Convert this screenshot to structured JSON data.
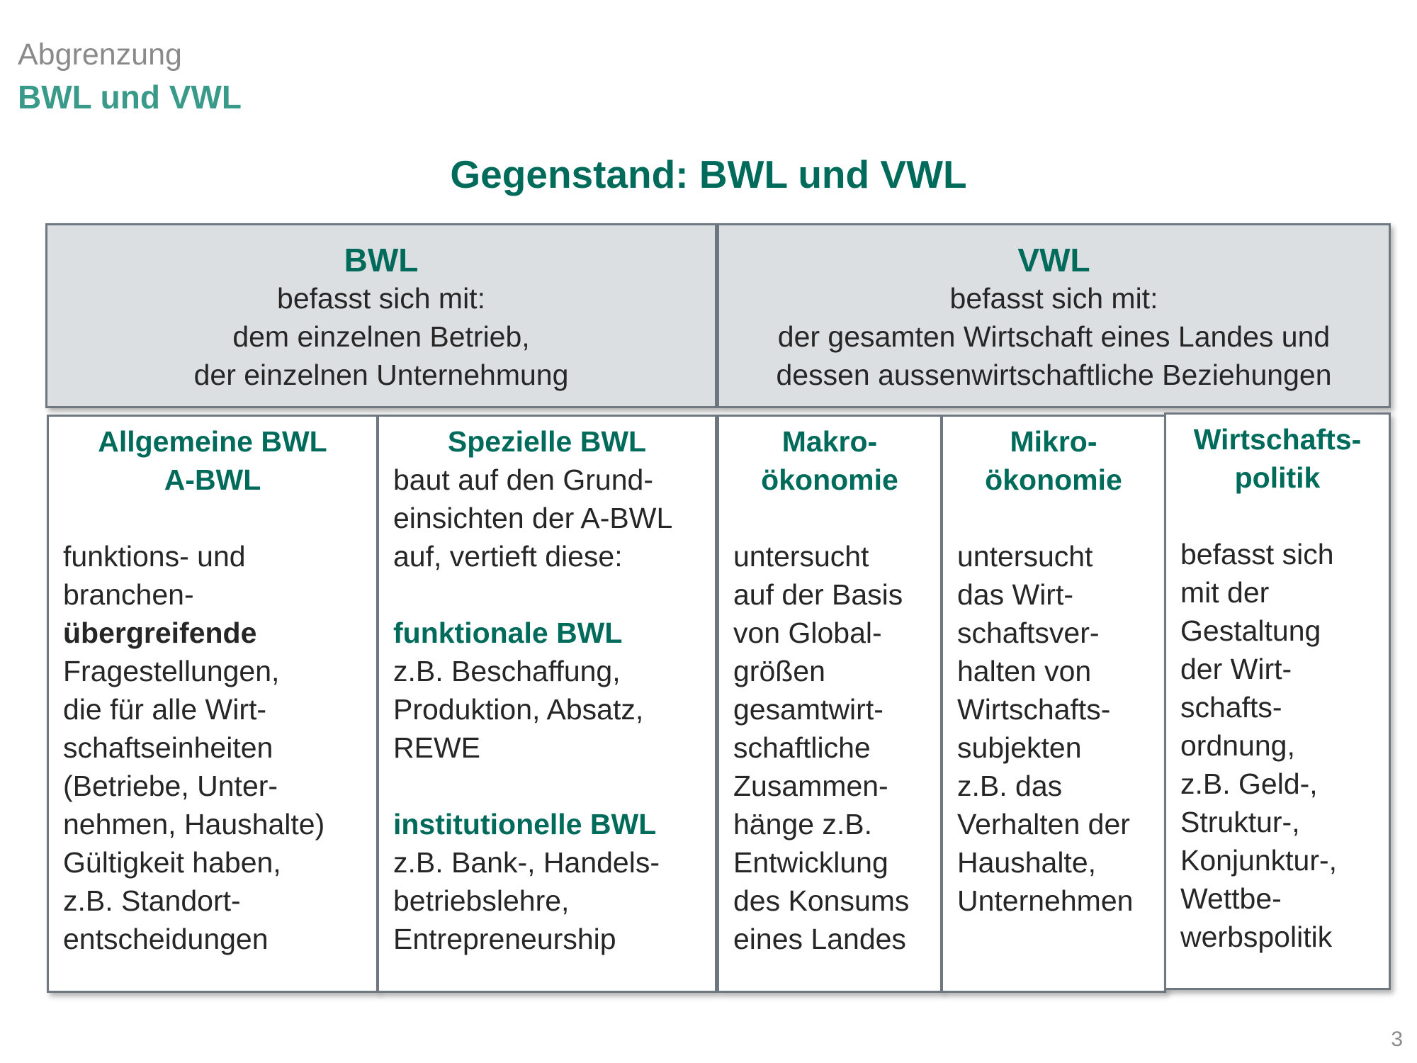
{
  "header": {
    "subtitle": "Abgrenzung",
    "title": "BWL und VWL"
  },
  "main_title": "Gegenstand: BWL und VWL",
  "bwl_box": {
    "title": "BWL",
    "line1": "befasst sich mit:",
    "line2": "dem einzelnen Betrieb,",
    "line3": "der einzelnen Unternehmung"
  },
  "vwl_box": {
    "title": "VWL",
    "line1": "befasst sich mit:",
    "line2": "der gesamten Wirtschaft eines Landes und",
    "line3": "dessen aussenwirtschaftliche Beziehungen"
  },
  "columns": {
    "abwl": {
      "title": "Allgemeine BWL\nA-BWL",
      "text_a": "funktions- und\nbranchen-",
      "text_bold": "übergreifende",
      "text_b": "Fragestellungen,\ndie für alle Wirt-\nschaftseinheiten\n(Betriebe, Unter-\nnehmen, Haushalte)\nGültigkeit haben,\nz.B. Standort-\nentscheidungen"
    },
    "sbwl": {
      "title": "Spezielle BWL",
      "intro": "baut auf den Grund-\neinsichten der A-BWL\nauf, vertieft diese:",
      "func_title": "funktionale BWL",
      "func_text": "z.B. Beschaffung,\nProduktion, Absatz,\nREWE",
      "inst_title": "institutionelle BWL",
      "inst_text": "z.B. Bank-, Handels-\nbetriebslehre,\nEntrepreneurship"
    },
    "makro": {
      "title": "Makro-\nökonomie",
      "text": "untersucht\nauf der Basis\nvon Global-\ngrößen\ngesamtwirt-\nschaftliche\nZusammen-\nhänge z.B.\nEntwicklung\ndes Konsums\neines Landes"
    },
    "mikro": {
      "title": "Mikro-\nökonomie",
      "text": "untersucht\ndas Wirt-\nschaftsver-\nhalten von\nWirtschafts-\nsubjekten\nz.B. das\nVerhalten der\nHaushalte,\nUnternehmen"
    },
    "wipo": {
      "title": "Wirtschafts-\npolitik",
      "text": "befasst sich\nmit der\nGestaltung\nder Wirt-\nschafts-\nordnung,\nz.B. Geld-,\nStruktur-,\nKonjunktur-,\nWettbe-\nwerbspolitik"
    }
  },
  "page_number": "3"
}
